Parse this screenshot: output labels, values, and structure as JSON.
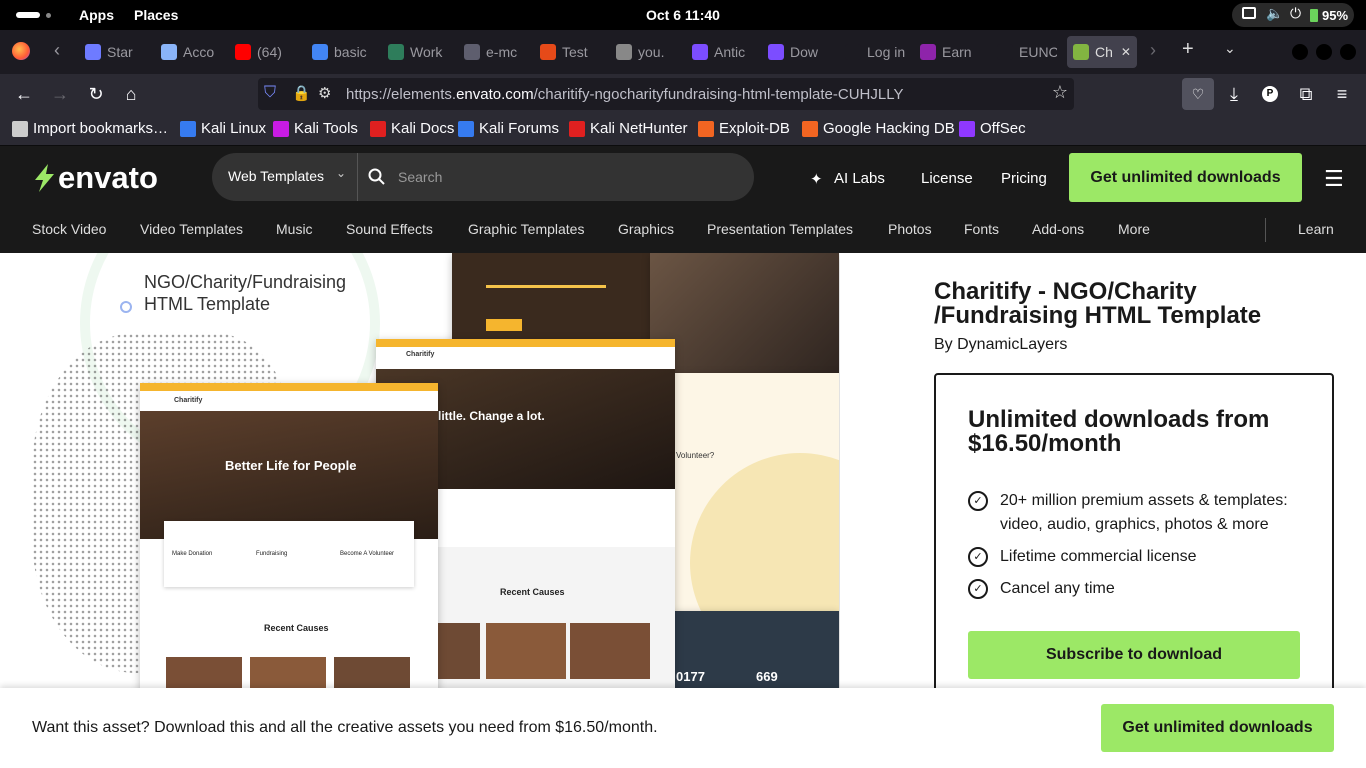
{
  "system_bar": {
    "apps": "Apps",
    "places": "Places",
    "datetime": "Oct 6  11:40",
    "battery": "95%"
  },
  "tabs": [
    {
      "label": "Star",
      "color": "#6e7bff"
    },
    {
      "label": "Acco",
      "color": "#8ab4f8"
    },
    {
      "label": "(64)",
      "color": "#ff0000"
    },
    {
      "label": "basic",
      "color": "#4285f4"
    },
    {
      "label": "Work",
      "color": "#2e7d5b"
    },
    {
      "label": "e-mc",
      "color": "#5e5e6e"
    },
    {
      "label": "Test",
      "color": "#e64a19"
    },
    {
      "label": "you.",
      "color": "#888888"
    },
    {
      "label": "Antic",
      "color": "#7c4dff"
    },
    {
      "label": "Dow",
      "color": "#7c4dff"
    },
    {
      "label": "Log in | I",
      "color": "#1c1b22"
    },
    {
      "label": "Earn",
      "color": "#8e24aa"
    },
    {
      "label": "EUNCCI",
      "color": "#1c1b22"
    },
    {
      "label": "Ch",
      "color": "#82b541"
    }
  ],
  "url": {
    "prefix": "https://elements.",
    "domain": "envato.com",
    "path": "/charitify-ngocharityfundraising-html-template-CUHJLLY"
  },
  "bookmarks": [
    {
      "label": "Import bookmarks…",
      "color": "#cccccc"
    },
    {
      "label": "Kali Linux",
      "color": "#367bf0"
    },
    {
      "label": "Kali Tools",
      "color": "#c81be4"
    },
    {
      "label": "Kali Docs",
      "color": "#e02020"
    },
    {
      "label": "Kali Forums",
      "color": "#367bf0"
    },
    {
      "label": "Kali NetHunter",
      "color": "#e02020"
    },
    {
      "label": "Exploit-DB",
      "color": "#f26522"
    },
    {
      "label": "Google Hacking DB",
      "color": "#f26522"
    },
    {
      "label": "OffSec",
      "color": "#8f38ff"
    }
  ],
  "envato": {
    "logo": "envato",
    "category_select": "Web Templates",
    "search_placeholder": "Search",
    "nav_ai": "AI Labs",
    "nav_license": "License",
    "nav_pricing": "Pricing",
    "cta": "Get unlimited downloads",
    "categories": [
      "Stock Video",
      "Video Templates",
      "Music",
      "Sound Effects",
      "Graphic Templates",
      "Graphics",
      "Presentation Templates",
      "Photos",
      "Fonts",
      "Add-ons",
      "More"
    ],
    "learn": "Learn"
  },
  "preview": {
    "heading": "NGO/Charity/Fundraising HTML Template",
    "mock_brand": "Charitify",
    "hero1": "Better Life for People",
    "hero2": "little. Change a lot.",
    "volunteer": "Volunteer?",
    "recent": "Recent Causes",
    "stat1": "0177",
    "stat2": "669",
    "cards": [
      "Make Donation",
      "Fundraising",
      "Become A Volunteer"
    ]
  },
  "product": {
    "title": "Charitify - NGO/Charity /Fundraising HTML Template",
    "author": "By DynamicLayers",
    "box_title": "Unlimited downloads from $16.50/month",
    "features": [
      "20+ million premium assets & templates: video, audio, graphics, photos & more",
      "Lifetime commercial license",
      "Cancel any time"
    ],
    "subscribe": "Subscribe to download"
  },
  "footer": {
    "text": "Want this asset? Download this and all the creative assets you need from $16.50/month.",
    "button": "Get unlimited downloads"
  },
  "colors": {
    "accent": "#9ce866",
    "header_bg": "#191919",
    "chrome_bg": "#2b2a33"
  }
}
